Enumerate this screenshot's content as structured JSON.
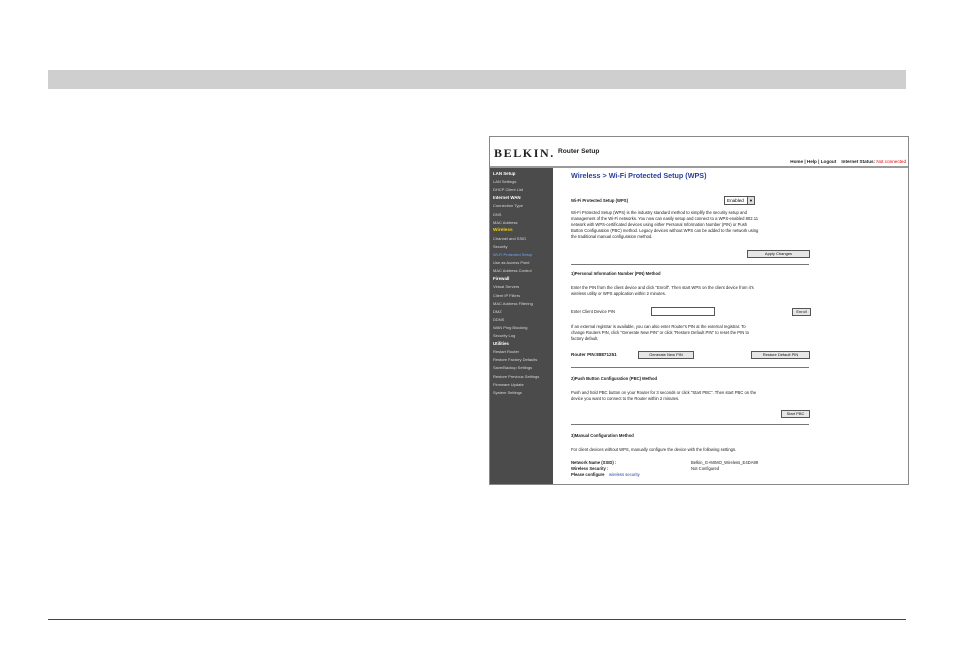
{
  "header": {
    "logo": "BELKIN.",
    "title": "Router Setup",
    "links": [
      "Home",
      "Help",
      "Logout"
    ],
    "status_label": "Internet Status:",
    "status_value": "Not connected"
  },
  "sidebar": [
    {
      "label": "LAN Setup",
      "kind": "h"
    },
    {
      "label": "LAN Settings",
      "kind": "i"
    },
    {
      "label": "DHCP Client List",
      "kind": "i"
    },
    {
      "label": "Internet WAN",
      "kind": "h"
    },
    {
      "label": "Connection Type",
      "kind": "i"
    },
    {
      "label": "DNS",
      "kind": "i"
    },
    {
      "label": "MAC Address",
      "kind": "i"
    },
    {
      "label": "Wireless",
      "kind": "cur"
    },
    {
      "label": "Channel and SSID",
      "kind": "i"
    },
    {
      "label": "Security",
      "kind": "i"
    },
    {
      "label": "Wi-Fi Protected Setup",
      "kind": "act"
    },
    {
      "label": "Use as Access Point",
      "kind": "i"
    },
    {
      "label": "MAC Address Control",
      "kind": "i"
    },
    {
      "label": "Firewall",
      "kind": "h"
    },
    {
      "label": "Virtual Servers",
      "kind": "i"
    },
    {
      "label": "Client IP Filters",
      "kind": "i"
    },
    {
      "label": "MAC Address Filtering",
      "kind": "i"
    },
    {
      "label": "DMZ",
      "kind": "i"
    },
    {
      "label": "DDNS",
      "kind": "i"
    },
    {
      "label": "WAN Ping Blocking",
      "kind": "i"
    },
    {
      "label": "Security Log",
      "kind": "i"
    },
    {
      "label": "Utilities",
      "kind": "h"
    },
    {
      "label": "Restart Router",
      "kind": "i"
    },
    {
      "label": "Restore Factory Defaults",
      "kind": "i"
    },
    {
      "label": "Save/Backup Settings",
      "kind": "i"
    },
    {
      "label": "Restore Previous Settings",
      "kind": "i"
    },
    {
      "label": "Firmware Update",
      "kind": "i"
    },
    {
      "label": "System Settings",
      "kind": "i"
    }
  ],
  "main": {
    "title": "Wireless  > Wi-Fi Protected Setup (WPS)",
    "wps_label": "Wi-Fi Protected Setup (WPS)",
    "wps_value": "Enabled",
    "intro": [
      "Wi-Fi Protected Setup (WPS) is the industry standard method to simplify the security setup and",
      "management of the Wi-Fi networks. You now can easily setup and connect to a WPS-enabled 802.11",
      "network with WPS-certificated devices using either Personal Information Number (PIN) or Push",
      "Button Configuration (PBC) method. Legacy devices without WPS can be added to the network using",
      "the traditional manual configuration method."
    ],
    "apply_btn": "Apply Changes",
    "pin_heading": "1)Personal Information Number (PIN) Method",
    "pin_text": [
      "Enter the PIN from the client device and click \"Enroll\". Then start WPS on the client device from it's",
      "wireless utility or WPS application within 2 minutes."
    ],
    "client_pin_label": "Enter Client Device PIN",
    "enroll_btn": "Enroll",
    "ext_text": [
      "If an external registrar is available, you can also enter Router's PIN at the external registrar. To",
      "change Routers PIN, click \"Generate New PIN\" or click \"Restore Default PIN\" to reset the PIN to",
      "factory default."
    ],
    "router_pin": "Router PIN:88871251",
    "gen_btn": "Generate New PIN",
    "restore_btn": "Restore Default PIN",
    "pbc_heading": "2)Push Button Configuration (PBC) Method",
    "pbc_text": [
      "Push and hold PBC button on your Router for 3 seconds or click \"Start PBC\". Then start PBC on the",
      "device you want to connect to the Router within 2 minutes."
    ],
    "pbc_btn": "Start PBC",
    "manual_heading": "3)Manual Configuration Method",
    "manual_text": "For client devices without WPS, manually configure the device with the following settings.",
    "ssid_label": "Network Name (SSID) :",
    "ssid_value": "Belkin_G+MIMO_Wireless_E4DA99",
    "sec_label": "Wireless Security :",
    "sec_value": "Not Configured",
    "configure_prefix": "Please configure",
    "configure_link": "wireless security"
  }
}
